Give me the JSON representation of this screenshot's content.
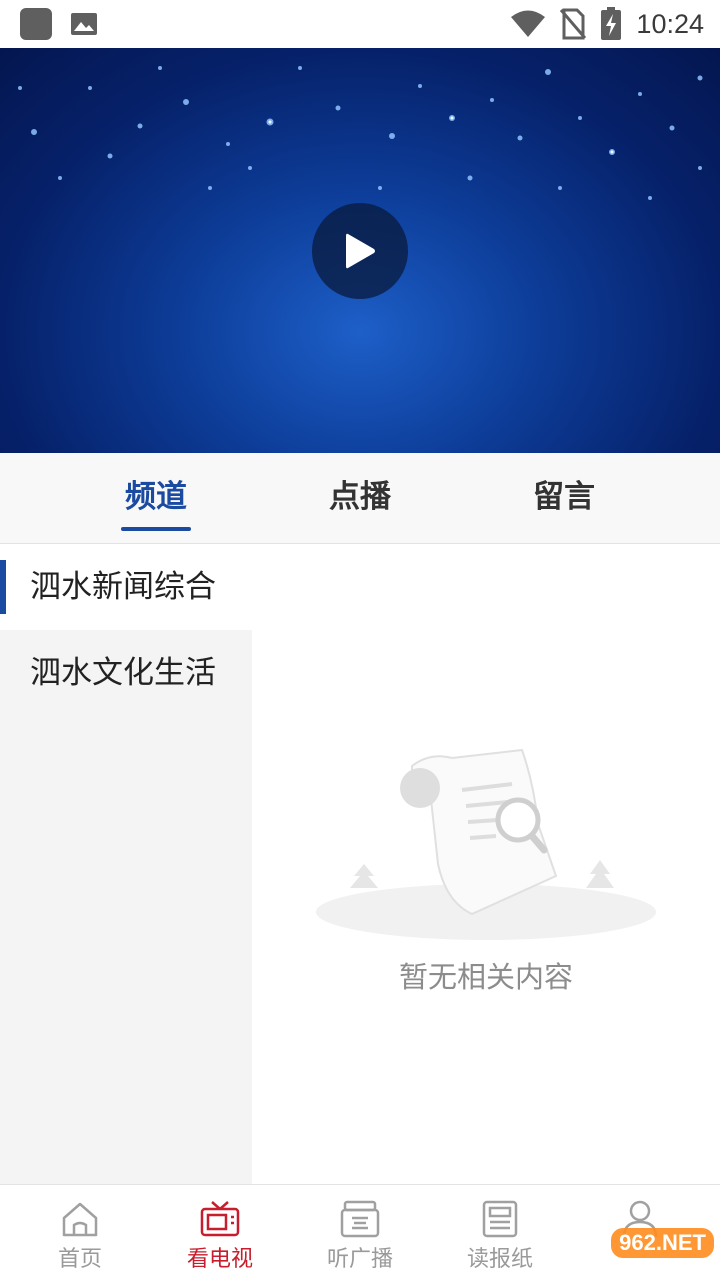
{
  "status_bar": {
    "time": "10:24"
  },
  "tabs": [
    {
      "label": "频道"
    },
    {
      "label": "点播"
    },
    {
      "label": "留言"
    }
  ],
  "channels": [
    {
      "label": "泗水新闻综合"
    },
    {
      "label": "泗水文化生活"
    }
  ],
  "empty_state": {
    "text": "暂无相关内容"
  },
  "bottom_nav": [
    {
      "label": "首页",
      "icon": "home-icon"
    },
    {
      "label": "看电视",
      "icon": "tv-icon"
    },
    {
      "label": "听广播",
      "icon": "radio-icon"
    },
    {
      "label": "读报纸",
      "icon": "newspaper-icon"
    },
    {
      "label": "",
      "icon": "user-icon"
    }
  ],
  "watermark": "962.NET",
  "colors": {
    "accent": "#1b4aa1",
    "active_nav": "#c81d2c"
  }
}
